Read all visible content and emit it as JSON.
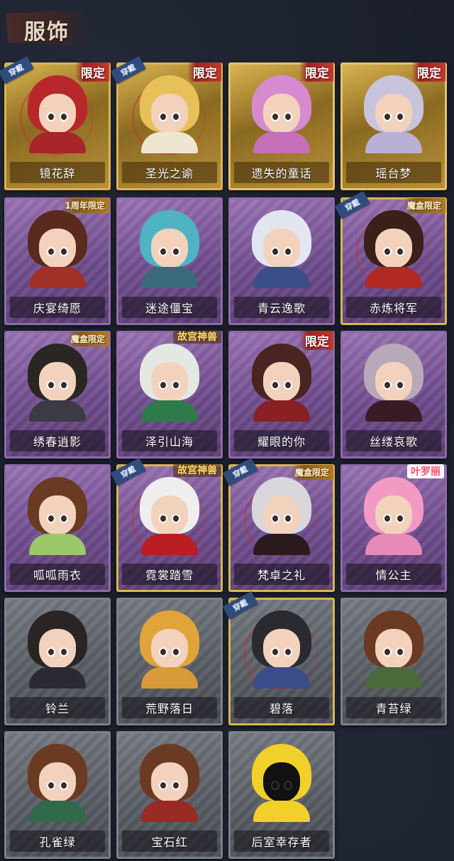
{
  "header": {
    "title": "服饰"
  },
  "colors": {
    "gold": "#d9b24f",
    "purple": "#8e6aa8",
    "gray": "#7b8089",
    "worn_badge": "#2f4c7d",
    "limited_badge": "#9b2424"
  },
  "cards": [
    {
      "name": "镜花辞",
      "rarity": "gold",
      "worn": true,
      "badge": {
        "type": "limited",
        "text": "限定"
      },
      "worn_label": "穿戴",
      "hair": "#b8282a",
      "outfit": "#a8252a"
    },
    {
      "name": "圣光之谕",
      "rarity": "gold",
      "worn": true,
      "badge": {
        "type": "limited",
        "text": "限定"
      },
      "worn_label": "穿戴",
      "hair": "#e8c05a",
      "outfit": "#efe6d2"
    },
    {
      "name": "遗失的童话",
      "rarity": "gold",
      "worn": false,
      "badge": {
        "type": "limited",
        "text": "限定"
      },
      "hair": "#d88ad0",
      "outfit": "#c56fb8"
    },
    {
      "name": "瑶台梦",
      "rarity": "gold",
      "worn": false,
      "badge": {
        "type": "limited",
        "text": "限定"
      },
      "hair": "#c8c4dc",
      "outfit": "#b9b0d6"
    },
    {
      "name": "庆宴绮愿",
      "rarity": "purple",
      "worn": false,
      "badge": {
        "type": "small",
        "text": "1周年限定"
      },
      "hair": "#5a2a1e",
      "outfit": "#a03028"
    },
    {
      "name": "迷途僵宝",
      "rarity": "purple",
      "worn": false,
      "badge": null,
      "hair": "#4fb3c2",
      "outfit": "#3b6b7a"
    },
    {
      "name": "青云逸歌",
      "rarity": "purple",
      "worn": false,
      "badge": null,
      "hair": "#e2e6f0",
      "outfit": "#3a4f8a"
    },
    {
      "name": "赤炼将军",
      "rarity": "purple",
      "worn": true,
      "badge": {
        "type": "small",
        "text": "魔盒限定"
      },
      "worn_label": "穿戴",
      "hair": "#3a2018",
      "outfit": "#b02a22"
    },
    {
      "name": "绣春逍影",
      "rarity": "purple",
      "worn": false,
      "badge": {
        "type": "small",
        "text": "魔盒限定"
      },
      "hair": "#2a2624",
      "outfit": "#3c3a44"
    },
    {
      "name": "泽引山海",
      "rarity": "purple",
      "worn": false,
      "badge": {
        "type": "legend",
        "text": "故宫神兽"
      },
      "hair": "#e4e8e2",
      "outfit": "#2f7a4a"
    },
    {
      "name": "耀眼的你",
      "rarity": "purple",
      "worn": false,
      "badge": {
        "type": "limited",
        "text": "限定"
      },
      "hair": "#4a2420",
      "outfit": "#8a1f24"
    },
    {
      "name": "丝缕哀歌",
      "rarity": "purple",
      "worn": false,
      "badge": null,
      "hair": "#b8a8b8",
      "outfit": "#3a1a24"
    },
    {
      "name": "呱呱雨衣",
      "rarity": "purple",
      "worn": false,
      "badge": null,
      "hair": "#6a3a22",
      "outfit": "#9ac86a"
    },
    {
      "name": "霓裳踏雪",
      "rarity": "purple",
      "worn": true,
      "badge": {
        "type": "legend",
        "text": "故宫神兽"
      },
      "worn_label": "穿戴",
      "hair": "#eeeeee",
      "outfit": "#b81e22"
    },
    {
      "name": "梵卓之礼",
      "rarity": "purple",
      "worn": true,
      "badge": {
        "type": "small",
        "text": "魔盒限定"
      },
      "worn_label": "穿戴",
      "hair": "#d8d8dc",
      "outfit": "#2a1a1e"
    },
    {
      "name": "情公主",
      "rarity": "purple",
      "worn": false,
      "badge": {
        "type": "pink",
        "text": "叶罗丽"
      },
      "hair": "#f29ac4",
      "outfit": "#e88ab8"
    },
    {
      "name": "铃兰",
      "rarity": "gray",
      "worn": false,
      "badge": null,
      "hair": "#2a2424",
      "outfit": "#2a2a32"
    },
    {
      "name": "荒野落日",
      "rarity": "gray",
      "worn": false,
      "badge": null,
      "hair": "#e0a43a",
      "outfit": "#d89a3a"
    },
    {
      "name": "碧落",
      "rarity": "gray",
      "worn": true,
      "badge": null,
      "worn_label": "穿戴",
      "hair": "#2a2a30",
      "outfit": "#3a4c8a"
    },
    {
      "name": "青苔绿",
      "rarity": "gray",
      "worn": false,
      "badge": null,
      "hair": "#6a3a22",
      "outfit": "#4a6a3a"
    },
    {
      "name": "孔雀绿",
      "rarity": "gray",
      "worn": false,
      "badge": null,
      "hair": "#6a3a22",
      "outfit": "#2f6a4a"
    },
    {
      "name": "宝石红",
      "rarity": "gray",
      "worn": false,
      "badge": null,
      "hair": "#6a3a22",
      "outfit": "#9a2a24"
    },
    {
      "name": "后室幸存者",
      "rarity": "gray",
      "worn": false,
      "badge": null,
      "hair": "#f2d02a",
      "outfit": "#f2d02a",
      "masked": true
    }
  ]
}
